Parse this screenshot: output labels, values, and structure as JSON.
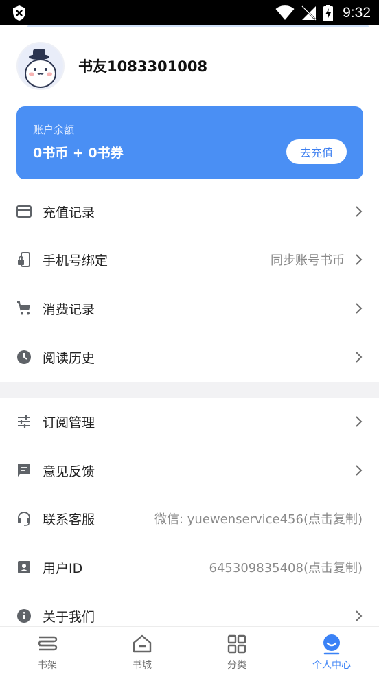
{
  "status_bar": {
    "time": "9:32"
  },
  "profile": {
    "username": "书友1083301008"
  },
  "balance": {
    "label": "账户余额",
    "value": "0书币 + 0书券",
    "button": "去充值"
  },
  "menu": [
    {
      "id": "recharge",
      "label": "充值记录",
      "value": "",
      "icon": "credit-card-icon",
      "arrow": true
    },
    {
      "id": "phone",
      "label": "手机号绑定",
      "value": "同步账号书币",
      "icon": "phone-lock-icon",
      "arrow": true
    },
    {
      "id": "consume",
      "label": "消费记录",
      "value": "",
      "icon": "cart-icon",
      "arrow": true
    },
    {
      "id": "history",
      "label": "阅读历史",
      "value": "",
      "icon": "clock-icon",
      "arrow": true
    },
    {
      "id": "subscribe",
      "label": "订阅管理",
      "value": "",
      "icon": "sliders-icon",
      "arrow": true
    },
    {
      "id": "feedback",
      "label": "意见反馈",
      "value": "",
      "icon": "feedback-icon",
      "arrow": true
    },
    {
      "id": "service",
      "label": "联系客服",
      "value": "微信: yuewenservice456(点击复制)",
      "icon": "headset-icon",
      "arrow": false
    },
    {
      "id": "userid",
      "label": "用户ID",
      "value": "645309835408(点击复制)",
      "icon": "id-badge-icon",
      "arrow": false
    },
    {
      "id": "about",
      "label": "关于我们",
      "value": "",
      "icon": "info-icon",
      "arrow": true
    }
  ],
  "nav": [
    {
      "label": "书架",
      "icon": "bookshelf-icon",
      "active": false
    },
    {
      "label": "书城",
      "icon": "bookstore-icon",
      "active": false
    },
    {
      "label": "分类",
      "icon": "category-grid-icon",
      "active": false
    },
    {
      "label": "个人中心",
      "icon": "profile-center-icon",
      "active": true
    }
  ],
  "colors": {
    "accent": "#4a8ff4",
    "active_nav": "#3b82f6",
    "icon_gray": "#5f6368"
  }
}
